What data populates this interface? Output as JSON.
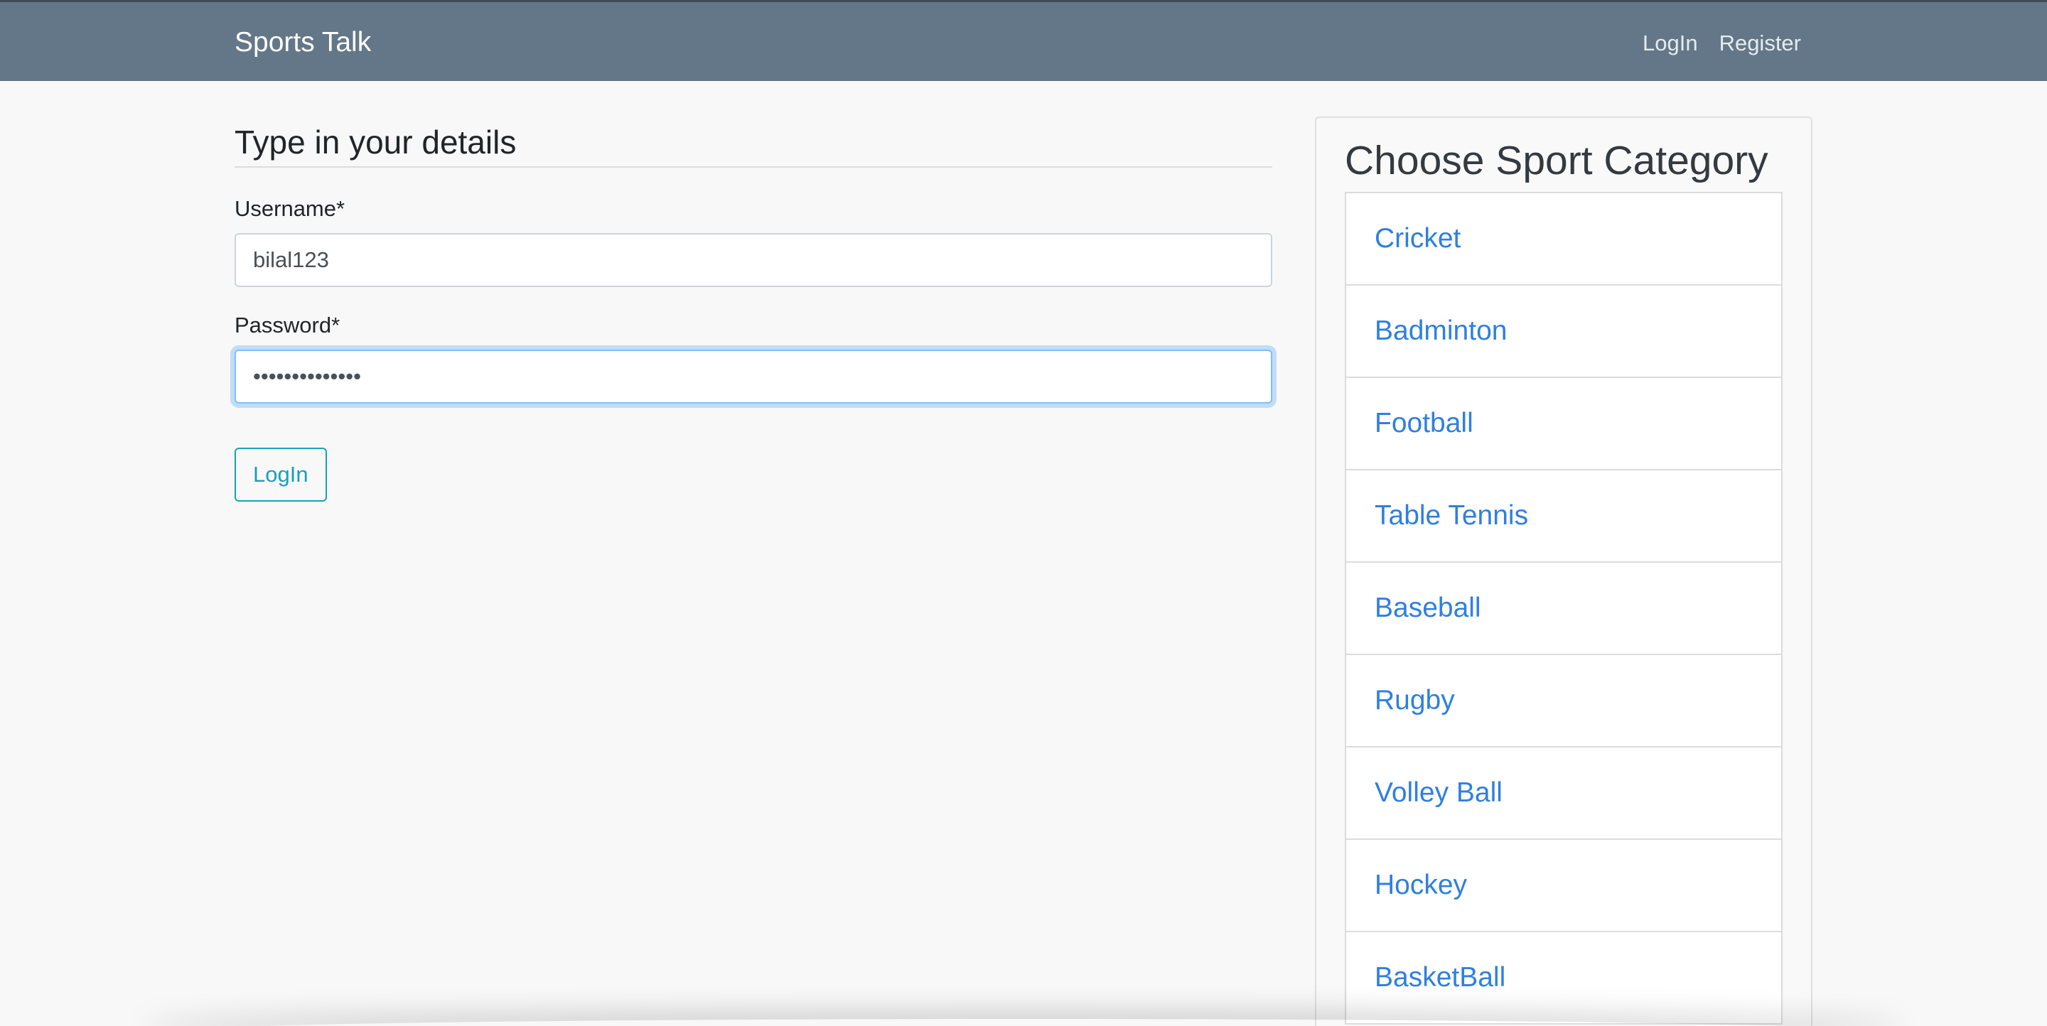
{
  "navbar": {
    "brand": "Sports Talk",
    "links": [
      "LogIn",
      "Register"
    ],
    "background": "#637789"
  },
  "form": {
    "legend": "Type in your details",
    "username_label": "Username*",
    "username_value": "bilal123",
    "password_label": "Password*",
    "password_value": "••••••••••••••",
    "submit_label": "LogIn"
  },
  "sidebar": {
    "title": "Choose Sport Category",
    "categories": [
      "Cricket",
      "Badminton",
      "Football",
      "Table Tennis",
      "Baseball",
      "Rugby",
      "Volley Ball",
      "Hockey",
      "BasketBall"
    ]
  },
  "colors": {
    "accent_link": "#2f7fe0",
    "button_outline": "#17a2b8"
  }
}
